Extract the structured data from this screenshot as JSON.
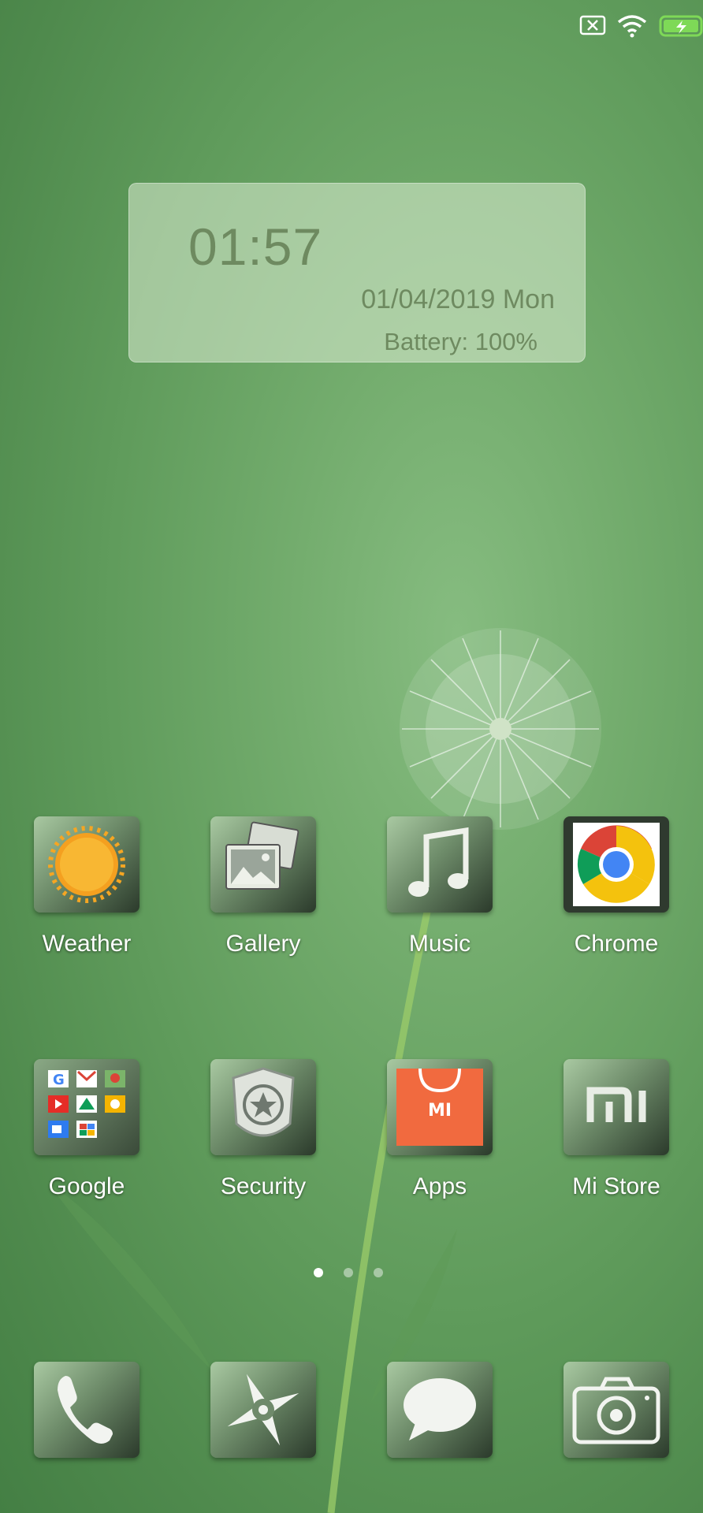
{
  "status_bar": {
    "icons": [
      "sim-off-icon",
      "wifi-icon",
      "battery-charging-icon"
    ],
    "battery_color": "#7ed957"
  },
  "clock_widget": {
    "time": "01:57",
    "date": "01/04/2019 Mon",
    "battery": "Battery: 100%"
  },
  "home_rows": [
    [
      {
        "label": "Weather",
        "icon": "sun-icon"
      },
      {
        "label": "Gallery",
        "icon": "photos-icon"
      },
      {
        "label": "Music",
        "icon": "music-note-icon"
      },
      {
        "label": "Chrome",
        "icon": "chrome-icon"
      }
    ],
    [
      {
        "label": "Google",
        "icon": "google-folder-icon"
      },
      {
        "label": "Security",
        "icon": "shield-badge-icon"
      },
      {
        "label": "Apps",
        "icon": "mi-bag-icon"
      },
      {
        "label": "Mi Store",
        "icon": "mi-logo-icon"
      }
    ]
  ],
  "page_indicator": {
    "pages": 3,
    "active": 1
  },
  "dock": [
    {
      "name": "Phone",
      "icon": "phone-icon"
    },
    {
      "name": "Browser",
      "icon": "compass-icon"
    },
    {
      "name": "Messages",
      "icon": "speech-bubble-icon"
    },
    {
      "name": "Camera",
      "icon": "camera-icon"
    }
  ],
  "colors": {
    "wallpaper_green": "#6fa86a",
    "widget_text": "#6e8a60",
    "apps_orange": "#f16a3f"
  }
}
